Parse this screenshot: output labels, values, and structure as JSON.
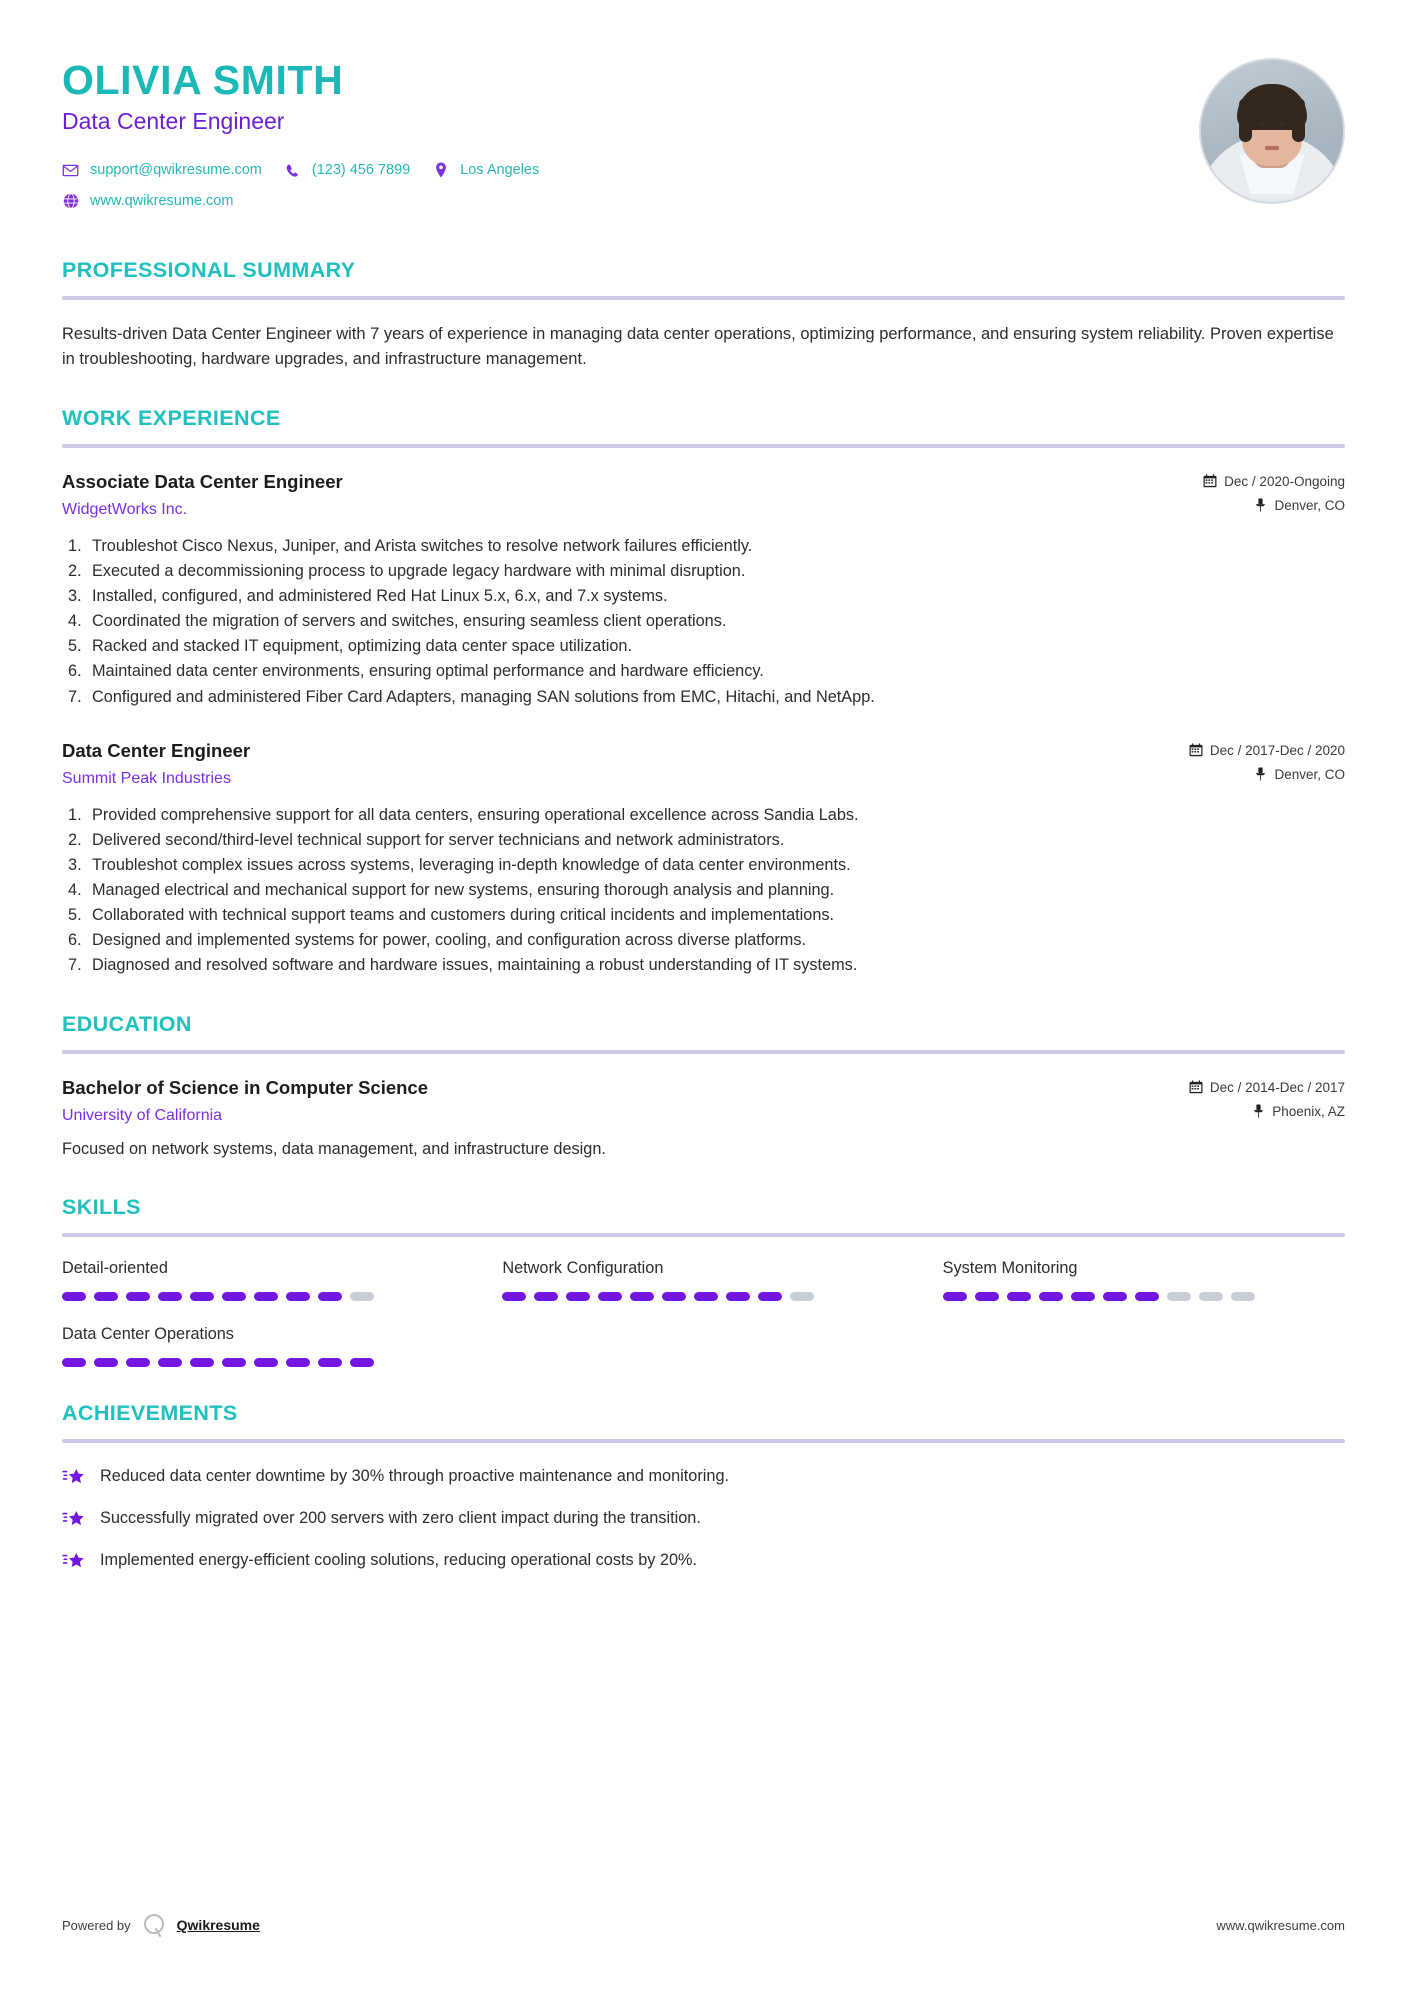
{
  "header": {
    "name": "OLIVIA SMITH",
    "job_title": "Data Center Engineer",
    "contacts_row1": [
      {
        "icon": "envelope-icon",
        "text": "support@qwikresume.com"
      },
      {
        "icon": "phone-icon",
        "text": "(123) 456 7899"
      },
      {
        "icon": "map-pin-icon",
        "text": "Los Angeles"
      }
    ],
    "contacts_row2": [
      {
        "icon": "globe-icon",
        "text": "www.qwikresume.com"
      }
    ],
    "photo_alt": "profile-photo"
  },
  "summary": {
    "title": "PROFESSIONAL SUMMARY",
    "text": "Results-driven Data Center Engineer with 7 years of experience in managing data center operations, optimizing performance, and ensuring system reliability. Proven expertise in troubleshooting, hardware upgrades, and infrastructure management."
  },
  "experience": {
    "title": "WORK EXPERIENCE",
    "entries": [
      {
        "role": "Associate Data Center Engineer",
        "company": "WidgetWorks Inc.",
        "dates": "Dec / 2020-Ongoing",
        "location": "Denver, CO",
        "bullets": [
          "Troubleshot Cisco Nexus, Juniper, and Arista switches to resolve network failures efficiently.",
          "Executed a decommissioning process to upgrade legacy hardware with minimal disruption.",
          "Installed, configured, and administered Red Hat Linux 5.x, 6.x, and 7.x systems.",
          "Coordinated the migration of servers and switches, ensuring seamless client operations.",
          "Racked and stacked IT equipment, optimizing data center space utilization.",
          "Maintained data center environments, ensuring optimal performance and hardware efficiency.",
          "Configured and administered Fiber Card Adapters, managing SAN solutions from EMC, Hitachi, and NetApp."
        ]
      },
      {
        "role": "Data Center Engineer",
        "company": "Summit Peak Industries",
        "dates": "Dec / 2017-Dec / 2020",
        "location": "Denver, CO",
        "bullets": [
          "Provided comprehensive support for all data centers, ensuring operational excellence across Sandia Labs.",
          "Delivered second/third-level technical support for server technicians and network administrators.",
          "Troubleshot complex issues across systems, leveraging in-depth knowledge of data center environments.",
          "Managed electrical and mechanical support for new systems, ensuring thorough analysis and planning.",
          "Collaborated with technical support teams and customers during critical incidents and implementations.",
          "Designed and implemented systems for power, cooling, and configuration across diverse platforms.",
          "Diagnosed and resolved software and hardware issues, maintaining a robust understanding of IT systems."
        ]
      }
    ]
  },
  "education": {
    "title": "EDUCATION",
    "entries": [
      {
        "degree": "Bachelor of Science in Computer Science",
        "school": "University of California",
        "dates": "Dec / 2014-Dec / 2017",
        "location": "Phoenix, AZ",
        "description": "Focused on network systems, data management, and infrastructure design."
      }
    ]
  },
  "skills": {
    "title": "SKILLS",
    "total_dashes": 10,
    "items": [
      {
        "name": "Detail-oriented",
        "level": 9
      },
      {
        "name": "Network Configuration",
        "level": 9
      },
      {
        "name": "System Monitoring",
        "level": 7
      },
      {
        "name": "Data Center Operations",
        "level": 10
      }
    ]
  },
  "achievements": {
    "title": "ACHIEVEMENTS",
    "items": [
      {
        "icon": "shooting-star-icon",
        "text": "Reduced data center downtime by 30% through proactive maintenance and monitoring."
      },
      {
        "icon": "shooting-star-icon",
        "text": "Successfully migrated over 200 servers with zero client impact during the transition."
      },
      {
        "icon": "shooting-star-icon",
        "text": "Implemented energy-efficient cooling solutions, reducing operational costs by 20%."
      }
    ]
  },
  "footer": {
    "powered_by": "Powered by",
    "brand": "Qwikresume",
    "website": "www.qwikresume.com"
  },
  "colors": {
    "teal": "#1fc0bd",
    "purple": "#7316e0",
    "rule": "#cdc9e8",
    "dash_off": "#c9cdd4"
  }
}
